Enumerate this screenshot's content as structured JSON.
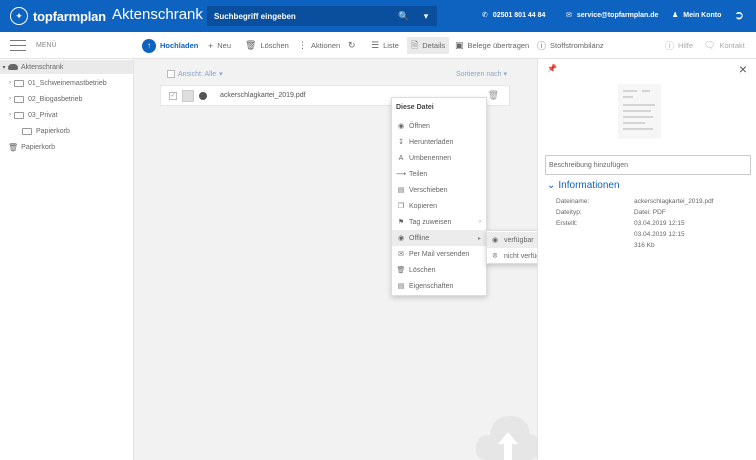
{
  "header": {
    "brand_name": "topfarmplan",
    "app_title": "Aktenschrank",
    "search_placeholder": "Suchbegriff eingeben",
    "phone": "02501 801 44 84",
    "email": "service@topfarmplan.de",
    "account": "Mein Konto"
  },
  "toolbar": {
    "menu_label": "MENÜ",
    "upload": "Hochladen",
    "new": "Neu",
    "delete": "Löschen",
    "actions": "Aktionen",
    "list": "Liste",
    "details": "Details",
    "transfer": "Belege übertragen",
    "stoffstrom": "Stoffstrombilanz",
    "help": "Hilfe",
    "contact": "Kontakt"
  },
  "tree": {
    "root": "Aktenschrank",
    "items": [
      "01_Schweinemastbetrieb",
      "02_Biogasbetrieb",
      "03_Privat",
      "Papierkorb"
    ],
    "trash": "Papierkorb"
  },
  "main": {
    "view_label": "Ansicht: Alle",
    "sort_label": "Sortieren nach",
    "file_name": "ackerschlagkartei_2019.pdf"
  },
  "context_menu": {
    "title": "Diese Datei",
    "items": [
      {
        "label": "Öffnen",
        "icon": "eye-icon"
      },
      {
        "label": "Herunterladen",
        "icon": "download-icon"
      },
      {
        "label": "Umbenennen",
        "icon": "rename-icon"
      },
      {
        "label": "Teilen",
        "icon": "share-icon"
      },
      {
        "label": "Verschieben",
        "icon": "move-icon"
      },
      {
        "label": "Kopieren",
        "icon": "copy-icon"
      },
      {
        "label": "Tag zuweisen",
        "icon": "tag-icon"
      },
      {
        "label": "Offline",
        "icon": "offline-icon"
      },
      {
        "label": "Per Mail versenden",
        "icon": "mail-icon"
      },
      {
        "label": "Löschen",
        "icon": "trash-icon"
      },
      {
        "label": "Eigenschaften",
        "icon": "properties-icon"
      }
    ],
    "submenu": [
      "verfügbar",
      "nicht verfügbar"
    ]
  },
  "details": {
    "description_placeholder": "Beschreibung hinzufügen",
    "info_title": "Informationen",
    "rows": [
      {
        "key": "Dateiname:",
        "value": "ackerschlagkartei_2019.pdf"
      },
      {
        "key": "Dateityp:",
        "value": "Datei: PDF"
      },
      {
        "key": "Erstellt:",
        "value": "03.04.2019 12:15"
      },
      {
        "key": "",
        "value": "03.04.2019 12:15"
      },
      {
        "key": "",
        "value": "316 Kb"
      }
    ]
  },
  "colors": {
    "brand": "#0e62c0",
    "accent_orange": "#e0762b"
  }
}
